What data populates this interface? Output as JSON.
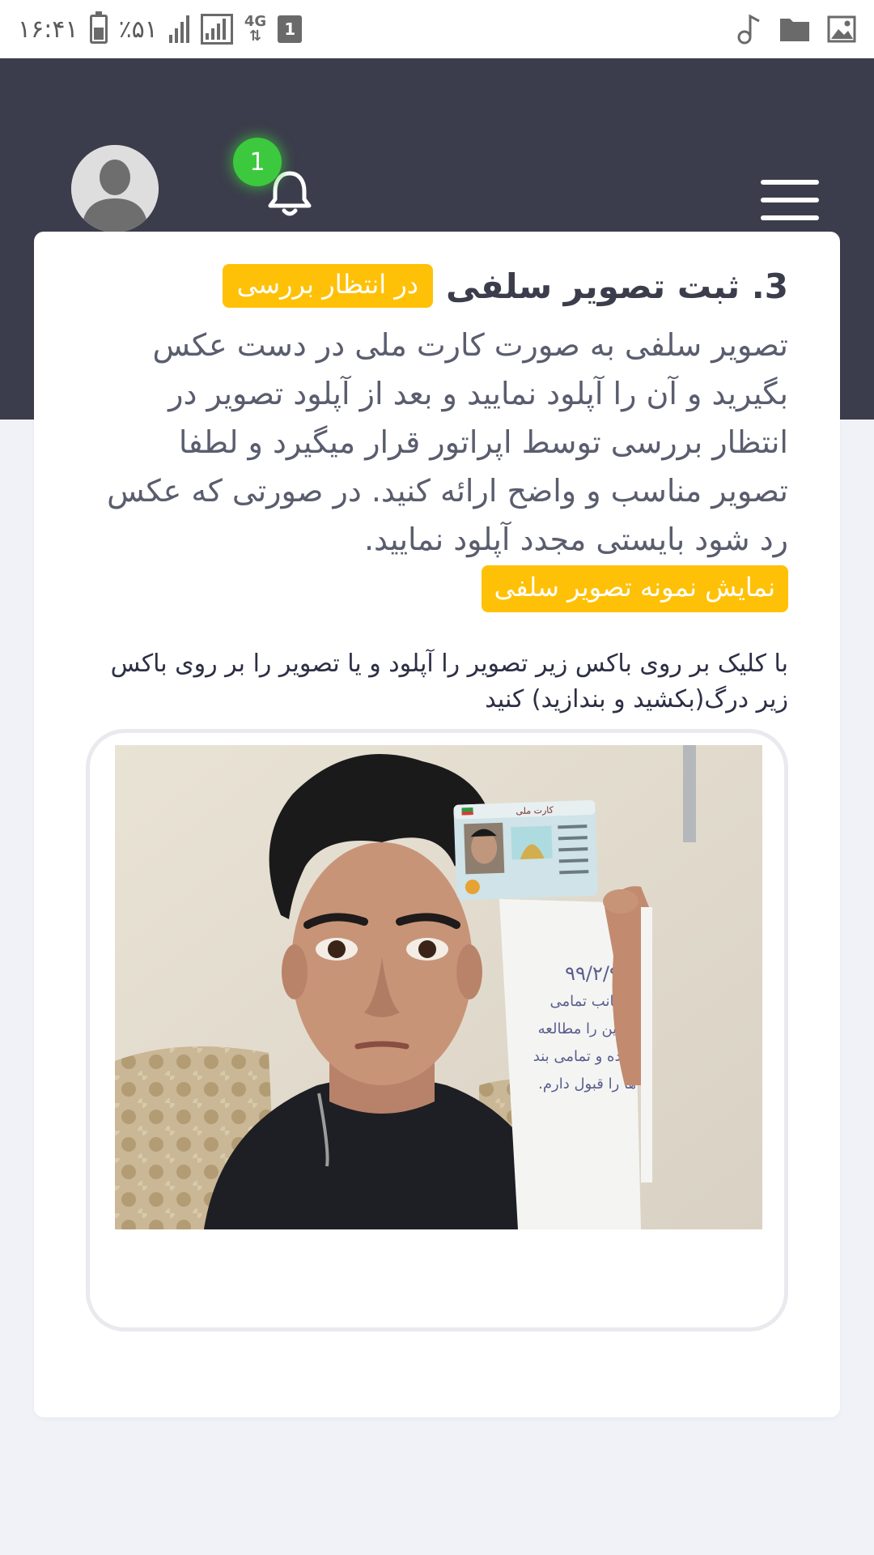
{
  "status_bar": {
    "time": "۱۶:۴۱",
    "battery": "٪۵۱",
    "network": "4G",
    "sim": "1"
  },
  "header": {
    "notification_count": "1"
  },
  "card": {
    "step_title": "3. ثبت تصویر سلفی",
    "status_badge": "در انتظار بررسی",
    "description": "تصویر سلفی به صورت کارت ملی در دست عکس بگیرید و آن را آپلود نمایید و بعد از آپلود تصویر در انتظار بررسی توسط اپراتور قرار میگیرد و لطفا تصویر مناسب و واضح ارائه کنید. در صورتی که عکس رد شود بایستی مجدد آپلود نمایید.",
    "sample_button": "نمایش نمونه تصویر سلفی",
    "upload_hint": "با کلیک بر روی باکس زیر تصویر را آپلود و یا تصویر را بر روی باکس زیر درگ(بکشید و بندازید) کنید"
  },
  "photo": {
    "card_title": "کارت ملی",
    "note_date": "۹۹/۲/۹",
    "note_text": "اینجانب تمامی معاین را مطالعه کرده و تمامی بند ها را قبول دارم."
  },
  "colors": {
    "header_bg": "#3c3d4c",
    "accent": "#ffc107",
    "badge_green": "#3cc93e",
    "page_bg": "#f1f2f8"
  },
  "icons": [
    "music-note-icon",
    "folder-icon",
    "image-icon",
    "bell-icon",
    "menu-icon",
    "avatar-icon"
  ]
}
